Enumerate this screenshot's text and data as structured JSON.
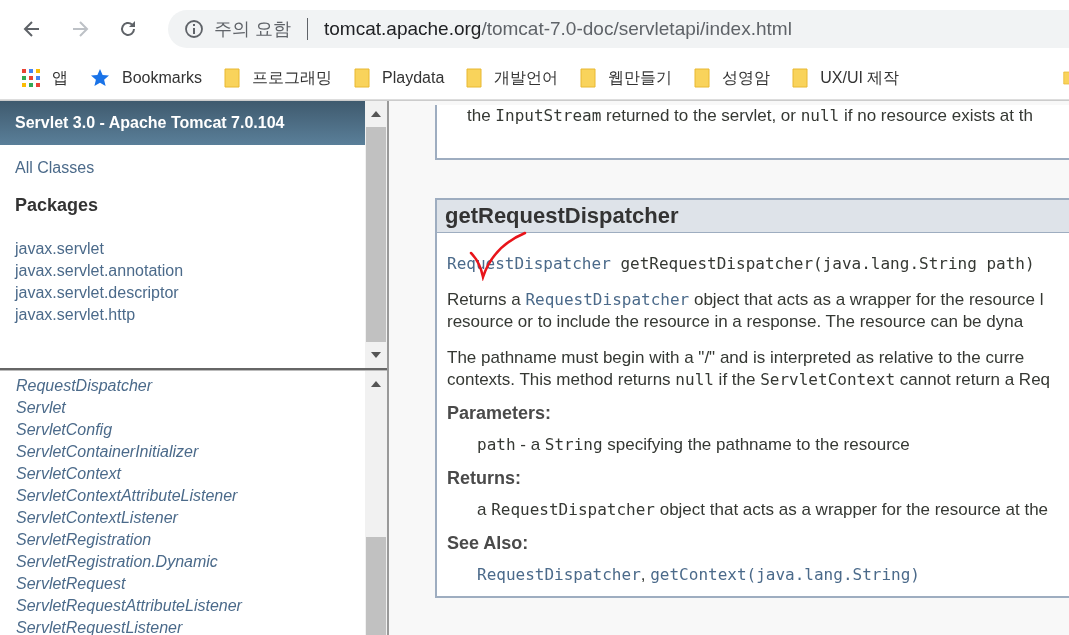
{
  "browser": {
    "security_label": "주의 요함",
    "url_host": "tomcat.apache.org",
    "url_path": "/tomcat-7.0-doc/servletapi/index.html"
  },
  "bookmarks": [
    {
      "label": "앱",
      "kind": "apps"
    },
    {
      "label": "Bookmarks",
      "kind": "star"
    },
    {
      "label": "프로그래밍",
      "kind": "folder"
    },
    {
      "label": "Playdata",
      "kind": "folder"
    },
    {
      "label": "개발언어",
      "kind": "folder"
    },
    {
      "label": "웹만들기",
      "kind": "folder"
    },
    {
      "label": "성영암",
      "kind": "folder"
    },
    {
      "label": "UX/UI 제작",
      "kind": "folder"
    },
    {
      "kind": "folder"
    }
  ],
  "packages_frame": {
    "title": "Servlet 3.0 - Apache Tomcat 7.0.104",
    "all_classes": "All Classes",
    "heading": "Packages",
    "packages": [
      "javax.servlet",
      "javax.servlet.annotation",
      "javax.servlet.descriptor",
      "javax.servlet.http"
    ]
  },
  "classes_frame": {
    "classes": [
      "RequestDispatcher",
      "Servlet",
      "ServletConfig",
      "ServletContainerInitializer",
      "ServletContext",
      "ServletContextAttributeListener",
      "ServletContextListener",
      "ServletRegistration",
      "ServletRegistration.Dynamic",
      "ServletRequest",
      "ServletRequestAttributeListener",
      "ServletRequestListener"
    ]
  },
  "content": {
    "previous_line": [
      {
        "kind": "text",
        "text": "the "
      },
      {
        "kind": "code",
        "text": "InputStream"
      },
      {
        "kind": "text",
        "text": " returned to the servlet, or "
      },
      {
        "kind": "code",
        "text": "null"
      },
      {
        "kind": "text",
        "text": " if no resource exists at th"
      }
    ],
    "method_name": "getRequestDispatcher",
    "signature": [
      {
        "kind": "link",
        "text": "RequestDispatcher"
      },
      {
        "kind": "code",
        "text": " getRequestDispatcher(java.lang.String path)"
      }
    ],
    "paragraphs": [
      [
        {
          "kind": "text",
          "text": "Returns a "
        },
        {
          "kind": "link",
          "text": "RequestDispatcher"
        },
        {
          "kind": "text",
          "text": " object that acts as a wrapper for the resource l"
        }
      ],
      [
        {
          "kind": "text",
          "text": "resource or to include the resource in a response. The resource can be dyna"
        }
      ],
      [
        {
          "kind": "text",
          "text": "The pathname must begin with a \"/\" and is interpreted as relative to the curre"
        }
      ],
      [
        {
          "kind": "text",
          "text": "contexts. This method returns "
        },
        {
          "kind": "code",
          "text": "null"
        },
        {
          "kind": "text",
          "text": " if the "
        },
        {
          "kind": "code",
          "text": "ServletContext"
        },
        {
          "kind": "text",
          "text": " cannot return a Req"
        }
      ]
    ],
    "sections": [
      {
        "heading": "Parameters:",
        "line": [
          {
            "kind": "code",
            "text": "path"
          },
          {
            "kind": "text",
            "text": " - a "
          },
          {
            "kind": "code",
            "text": "String"
          },
          {
            "kind": "text",
            "text": " specifying the pathname to the resource"
          }
        ]
      },
      {
        "heading": "Returns:",
        "line": [
          {
            "kind": "text",
            "text": "a "
          },
          {
            "kind": "code",
            "text": "RequestDispatcher"
          },
          {
            "kind": "text",
            "text": " object that acts as a wrapper for the resource at the"
          }
        ]
      },
      {
        "heading": "See Also:",
        "line": [
          {
            "kind": "link",
            "text": "RequestDispatcher"
          },
          {
            "kind": "text",
            "text": ", "
          },
          {
            "kind": "link",
            "text": "getContext(java.lang.String)"
          }
        ]
      }
    ]
  }
}
